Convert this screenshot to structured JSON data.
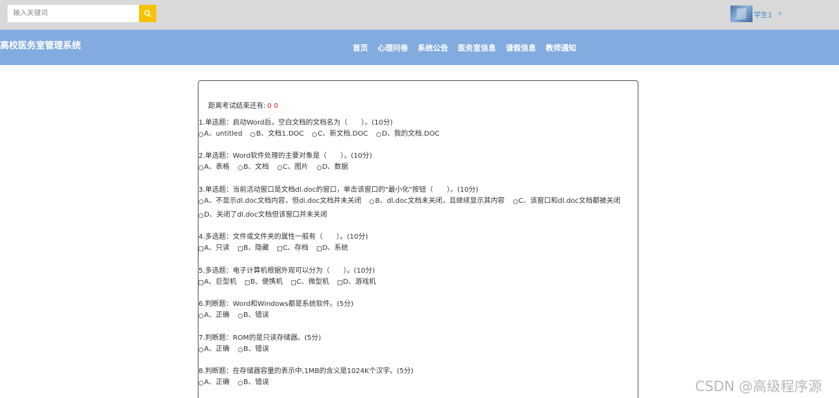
{
  "search": {
    "placeholder": "输入关键词"
  },
  "user": {
    "name": "学生1"
  },
  "site": {
    "title": "高校医务室管理系统"
  },
  "nav": {
    "items": [
      "首页",
      "心理问卷",
      "系统公告",
      "医务室信息",
      "请假信息",
      "教师通知"
    ]
  },
  "exam": {
    "timer_label": "距离考试结束还有:",
    "timer_value": "0 0",
    "questions": [
      {
        "title": "1.单选题：启动Word后，空白文档的文档名为（　　）。(10分)",
        "input": "radio",
        "options": [
          "A、untitled",
          "B、文档1.DOC",
          "C、新文档.DOC",
          "D、我的文档.DOC"
        ]
      },
      {
        "title": "2.单选题：Word软件处理的主要对象是（　　）。(10分)",
        "input": "radio",
        "options": [
          "A、表格",
          "B、文档",
          "C、图片",
          "D、数据"
        ]
      },
      {
        "title": "3.单选题：当前活动窗口是文档dl.doc的窗口，单击该窗口的\"最小化\"按钮（　　）。(10分)",
        "input": "radio",
        "options": [
          "A、不显示dl.doc文档内容，但dl.doc文档并未关闭",
          "B、dl.doc文档未关闭，且继续显示其内容",
          "C、该窗口和dl.doc文档都被关闭",
          "D、关闭了dl.doc文档但该窗口并未关闭"
        ]
      },
      {
        "title": "4.多选题：文件或文件夹的属性一般有（　　）。(10分)",
        "input": "checkbox",
        "options": [
          "A、只读",
          "B、隐藏",
          "C、存档",
          "D、系统"
        ]
      },
      {
        "title": "5.多选题：电子计算机根据外观可以分为（　　）。(10分)",
        "input": "checkbox",
        "options": [
          "A、巨型机",
          "B、便携机",
          "C、微型机",
          "D、游戏机"
        ]
      },
      {
        "title": "6.判断题：Word和Windows都是系统软件。(5分)",
        "input": "radio",
        "options": [
          "A、正确",
          "B、错误"
        ]
      },
      {
        "title": "7.判断题：ROM的是只读存储器。(5分)",
        "input": "radio",
        "options": [
          "A、正确",
          "B、错误"
        ]
      },
      {
        "title": "8.判断题：在存储器容量的表示中,1MB的含义是1024K个汉字。(5分)",
        "input": "radio",
        "options": [
          "A、正确",
          "B、错误"
        ]
      }
    ]
  },
  "watermark": "CSDN @高级程序源"
}
